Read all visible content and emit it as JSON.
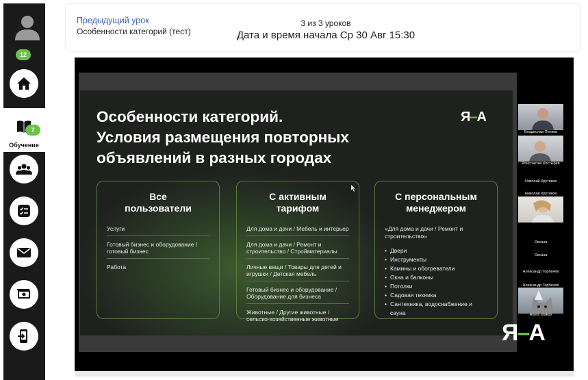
{
  "sidebar": {
    "notifications_badge": "12",
    "learning_badge": "7",
    "learning_label": "Обучение",
    "icons": [
      "user-avatar-icon",
      "home-icon",
      "book-icon",
      "group-icon",
      "checklist-icon",
      "mail-icon",
      "money-icon",
      "phone-exit-icon"
    ]
  },
  "header": {
    "prev_lesson_link": "Предыдущий урок",
    "lesson_name": "Особенности категорий (тест)",
    "lesson_count": "3 из 3 уроков",
    "start_time": "Дата и время начала Ср 30 Авг 15:30"
  },
  "slide": {
    "title_line1": "Особенности категорий.",
    "title_line2": "Условия размещения повторных",
    "title_line3": "объявлений в разных городах",
    "logo_left": "Я",
    "logo_right": "А",
    "cards": [
      {
        "title_line1": "Все",
        "title_line2": "пользователи",
        "items": [
          "Услуги",
          "Готовый бизнес и оборудование / готовый бизнес",
          "Работа"
        ]
      },
      {
        "title_line1": "С активным",
        "title_line2": "тарифом",
        "items": [
          "Для дома и дачи / Мебель и интерьер",
          "Для дома и дачи / Ремонт и строительство / Стройматериалы",
          "Личные вещи / Товары для детей и игрушки / Детская мебель",
          "Готовый бизнес и оборудование / Оборудование для бизнеса",
          "Животные / Другие животные / сельско-хозяйственные животные"
        ]
      },
      {
        "title_line1": "С персональным",
        "title_line2": "менеджером",
        "quote": "«Для дома и дачи / Ремонт и строительство»",
        "bullets": [
          "Двери",
          "Инструменты",
          "Камины и обогреватели",
          "Окна и балконы",
          "Потолки",
          "Садовая техника",
          "Сантехника, водоснабжение и сауна"
        ]
      }
    ]
  },
  "participants": [
    {
      "name": "Владислав Попков"
    },
    {
      "name": "Константин Костырев"
    },
    {
      "name": "Николай Крутиков"
    },
    {
      "name": "Николай Крутиков"
    },
    {
      "name": "Оксана"
    },
    {
      "name": "Оксана"
    },
    {
      "name": "Александр Горбачёв"
    },
    {
      "name": "Александр Горбачёв"
    },
    {
      "name": "Artem Volkov"
    }
  ],
  "video_logo": {
    "left": "Я",
    "right": "А"
  },
  "colors": {
    "accent_green": "#6cc24a",
    "link_blue": "#3a63b8",
    "sidebar_dark": "#1a1a1a"
  }
}
